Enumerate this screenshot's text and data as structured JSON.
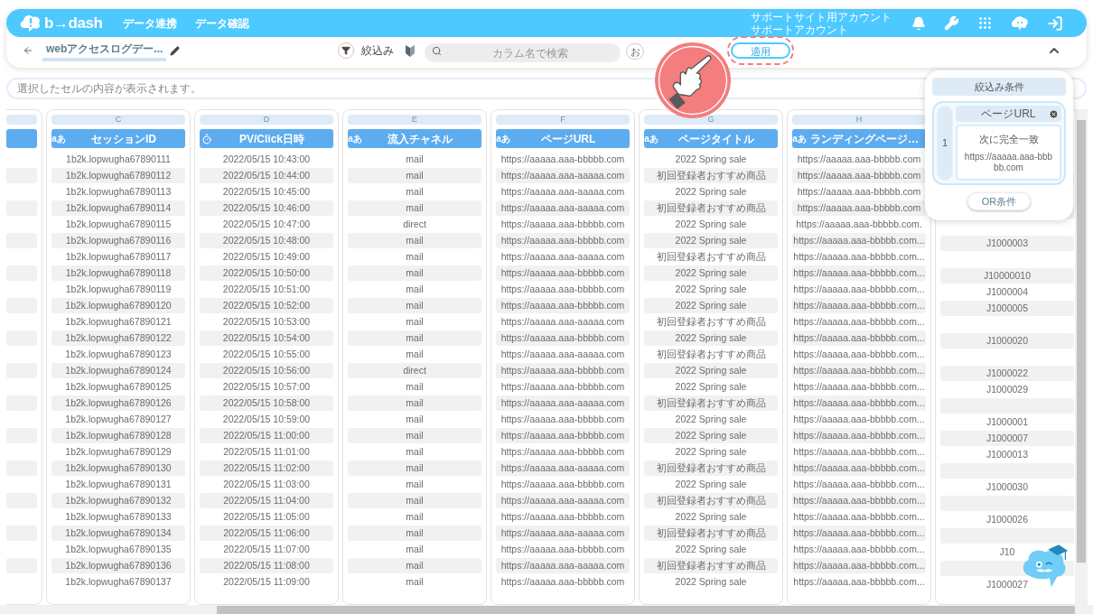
{
  "header": {
    "logo": "b→dash",
    "nav": [
      "データ連携",
      "データ確認"
    ],
    "account": [
      "サポートサイト用アカウント",
      "サポートアカウント"
    ]
  },
  "toolbar": {
    "title": "webアクセスログデー...",
    "filter_label": "絞込み",
    "search": {
      "placeholder": "カラム名で検索"
    },
    "buttons": [
      {
        "label": "お",
        "highlighted": false
      },
      {
        "label": "適用",
        "highlighted": true
      }
    ]
  },
  "cell_preview": {
    "placeholder": "選択したセルの内容が表示されます。"
  },
  "columns": [
    {},
    {
      "letter": "C",
      "name": "セッションID",
      "kind": "text",
      "type_label": "aあ"
    },
    {
      "letter": "D",
      "name": "PV/Click日時",
      "kind": "datetime"
    },
    {
      "letter": "E",
      "name": "流入チャネル",
      "kind": "text",
      "type_label": "aあ"
    },
    {
      "letter": "F",
      "name": "ページURL",
      "kind": "text",
      "type_label": "aあ"
    },
    {
      "letter": "G",
      "name": "ページタイトル",
      "kind": "text",
      "type_label": "aあ"
    },
    {
      "letter": "H",
      "name": "ランディングページ…",
      "kind": "text",
      "type_label": "aあ"
    },
    {}
  ],
  "rows": [
    [
      null,
      "1b2k.lopwugha67890111",
      "2022/05/15 10:43:00",
      "mail",
      "https://aaaaa.aaa-bbbbb.com",
      "2022 Spring sale",
      "https://aaaaa.aaa-bbbbb.com",
      null
    ],
    [
      null,
      "1b2k.lopwugha67890112",
      "2022/05/15 10:44:00",
      "mail",
      "https://aaaaa.aaa-aaaaa.com",
      "初回登録者おすすめ商品",
      "https://aaaaa.aaa-bbbbb.com",
      null
    ],
    [
      null,
      "1b2k.lopwugha67890113",
      "2022/05/15 10:45:00",
      "mail",
      "https://aaaaa.aaa-aaaaa.com",
      "2022 Spring sale",
      "https://aaaaa.aaa-bbbbb.com",
      null
    ],
    [
      null,
      "1b2k.lopwugha67890114",
      "2022/05/15 10:46:00",
      "mail",
      "https://aaaaa.aaa-aaaaa.com",
      "初回登録者おすすめ商品",
      "https://aaaaa.aaa-bbbbb.com",
      null
    ],
    [
      null,
      "1b2k.lopwugha67890115",
      "2022/05/15 10:47:00",
      "direct",
      "https://aaaaa.aaa-bbbbb.com",
      "2022 Spring sale",
      "https://aaaaa.aaa-bbbbb.com.",
      null
    ],
    [
      null,
      "1b2k.lopwugha67890116",
      "2022/05/15 10:48:00",
      "mail",
      "https://aaaaa.aaa-bbbbb.com",
      "2022 Spring sale",
      "https://aaaaa.aaa-bbbbb.com...",
      "J1000003"
    ],
    [
      null,
      "1b2k.lopwugha67890117",
      "2022/05/15 10:49:00",
      "mail",
      "https://aaaaa.aaa-aaaaa.com",
      "初回登録者おすすめ商品",
      "https://aaaaa.aaa-bbbbb.com...",
      null
    ],
    [
      null,
      "1b2k.lopwugha67890118",
      "2022/05/15 10:50:00",
      "mail",
      "https://aaaaa.aaa-bbbbb.com",
      "2022 Spring sale",
      "https://aaaaa.aaa-bbbbb.com...",
      "J10000010"
    ],
    [
      null,
      "1b2k.lopwugha67890119",
      "2022/05/15 10:51:00",
      "mail",
      "https://aaaaa.aaa-bbbbb.com",
      "2022 Spring sale",
      "https://aaaaa.aaa-bbbbb.com...",
      "J1000004"
    ],
    [
      null,
      "1b2k.lopwugha67890120",
      "2022/05/15 10:52:00",
      "mail",
      "https://aaaaa.aaa-bbbbb.com",
      "2022 Spring sale",
      "https://aaaaa.aaa-bbbbb.com...",
      "J1000005"
    ],
    [
      null,
      "1b2k.lopwugha67890121",
      "2022/05/15 10:53:00",
      "mail",
      "https://aaaaa.aaa-aaaaa.com",
      "初回登録者おすすめ商品",
      "https://aaaaa.aaa-bbbbb.com...",
      null
    ],
    [
      null,
      "1b2k.lopwugha67890122",
      "2022/05/15 10:54:00",
      "mail",
      "https://aaaaa.aaa-bbbbb.com",
      "2022 Spring sale",
      "https://aaaaa.aaa-bbbbb.com...",
      "J1000020"
    ],
    [
      null,
      "1b2k.lopwugha67890123",
      "2022/05/15 10:55:00",
      "mail",
      "https://aaaaa.aaa-aaaaa.com",
      "初回登録者おすすめ商品",
      "https://aaaaa.aaa-bbbbb.com...",
      null
    ],
    [
      null,
      "1b2k.lopwugha67890124",
      "2022/05/15 10:56:00",
      "direct",
      "https://aaaaa.aaa-bbbbb.com",
      "2022 Spring sale",
      "https://aaaaa.aaa-bbbbb.com...",
      "J1000022"
    ],
    [
      null,
      "1b2k.lopwugha67890125",
      "2022/05/15 10:57:00",
      "mail",
      "https://aaaaa.aaa-bbbbb.com",
      "2022 Spring sale",
      "https://aaaaa.aaa-bbbbb.com...",
      "J1000029"
    ],
    [
      null,
      "1b2k.lopwugha67890126",
      "2022/05/15 10:58:00",
      "mail",
      "https://aaaaa.aaa-aaaaa.com",
      "初回登録者おすすめ商品",
      "https://aaaaa.aaa-bbbbb.com...",
      null
    ],
    [
      null,
      "1b2k.lopwugha67890127",
      "2022/05/15 10:59:00",
      "mail",
      "https://aaaaa.aaa-bbbbb.com",
      "2022 Spring sale",
      "https://aaaaa.aaa-bbbbb.com...",
      "J1000001"
    ],
    [
      null,
      "1b2k.lopwugha67890128",
      "2022/05/15 11:00:00",
      "mail",
      "https://aaaaa.aaa-bbbbb.com",
      "2022 Spring sale",
      "https://aaaaa.aaa-bbbbb.com...",
      "J1000007"
    ],
    [
      null,
      "1b2k.lopwugha67890129",
      "2022/05/15 11:01:00",
      "mail",
      "https://aaaaa.aaa-bbbbb.com",
      "2022 Spring sale",
      "https://aaaaa.aaa-bbbbb.com...",
      "J1000013"
    ],
    [
      null,
      "1b2k.lopwugha67890130",
      "2022/05/15 11:02:00",
      "mail",
      "https://aaaaa.aaa-aaaaa.com",
      "初回登録者おすすめ商品",
      "https://aaaaa.aaa-bbbbb.com...",
      null
    ],
    [
      null,
      "1b2k.lopwugha67890131",
      "2022/05/15 11:03:00",
      "mail",
      "https://aaaaa.aaa-bbbbb.com",
      "2022 Spring sale",
      "https://aaaaa.aaa-bbbbb.com...",
      "J1000030"
    ],
    [
      null,
      "1b2k.lopwugha67890132",
      "2022/05/15 11:04:00",
      "mail",
      "https://aaaaa.aaa-aaaaa.com",
      "初回登録者おすすめ商品",
      "https://aaaaa.aaa-bbbbb.com...",
      null
    ],
    [
      null,
      "1b2k.lopwugha67890133",
      "2022/05/15 11:05:00",
      "mail",
      "https://aaaaa.aaa-bbbbb.com",
      "2022 Spring sale",
      "https://aaaaa.aaa-bbbbb.com...",
      "J1000026"
    ],
    [
      null,
      "1b2k.lopwugha67890134",
      "2022/05/15 11:06:00",
      "mail",
      "https://aaaaa.aaa-aaaaa.com",
      "初回登録者おすすめ商品",
      "https://aaaaa.aaa-bbbbb.com...",
      null
    ],
    [
      null,
      "1b2k.lopwugha67890135",
      "2022/05/15 11:07:00",
      "mail",
      "https://aaaaa.aaa-bbbbb.com",
      "2022 Spring sale",
      "https://aaaaa.aaa-bbbbb.com...",
      "J10"
    ],
    [
      null,
      "1b2k.lopwugha67890136",
      "2022/05/15 11:08:00",
      "mail",
      "https://aaaaa.aaa-aaaaa.com",
      "初回登録者おすすめ商品",
      "https://aaaaa.aaa-bbbbb.com...",
      null
    ],
    [
      null,
      "1b2k.lopwugha67890137",
      "2022/05/15 11:09:00",
      "mail",
      "https://aaaaa.aaa-bbbbb.com",
      "2022 Spring sale",
      "https://aaaaa.aaa-bbbbb.com...",
      "J1000027"
    ]
  ],
  "filter_panel": {
    "title": "絞込み条件",
    "groups": [
      {
        "number": "1",
        "conditions": [
          {
            "column": "ページURL",
            "operator": "次に完全一致",
            "value": "https://aaaaa.aaa-bbbbb.com"
          }
        ]
      }
    ],
    "or_button": "OR条件"
  }
}
